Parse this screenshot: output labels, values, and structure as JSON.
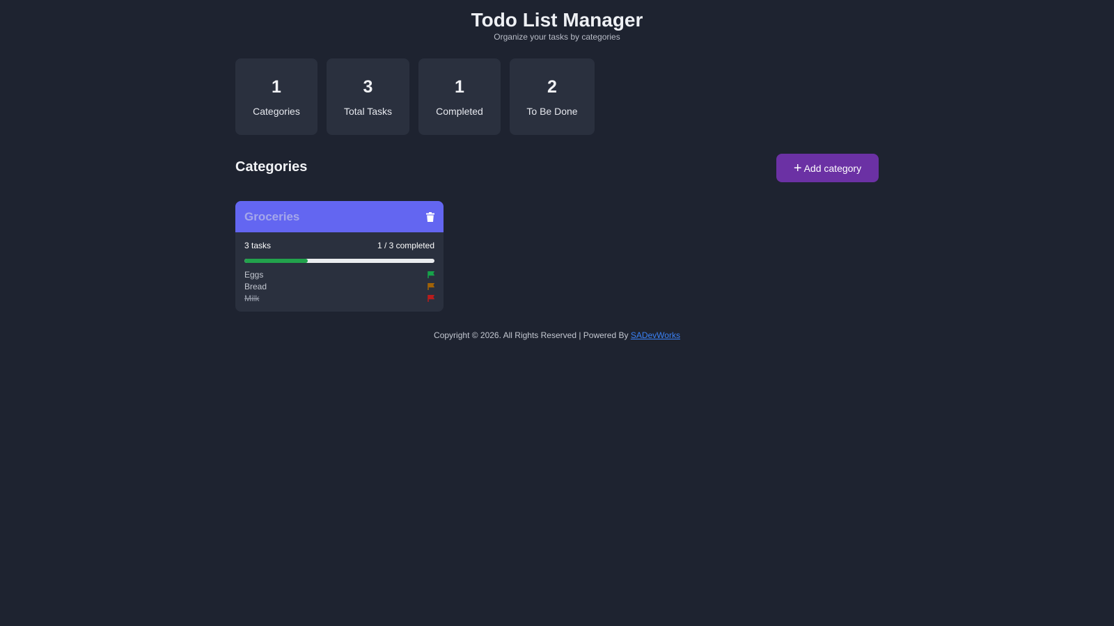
{
  "header": {
    "title": "Todo List Manager",
    "subtitle": "Organize your tasks by categories"
  },
  "stats": [
    {
      "value": "1",
      "label": "Categories"
    },
    {
      "value": "3",
      "label": "Total Tasks"
    },
    {
      "value": "1",
      "label": "Completed"
    },
    {
      "value": "2",
      "label": "To Be Done"
    }
  ],
  "categories_section": {
    "title": "Categories",
    "add_button": {
      "icon": "plus-icon",
      "label": "Add category"
    }
  },
  "categories": [
    {
      "name": "Groceries",
      "tasks_count_label": "3 tasks",
      "completed_label": "1 / 3 completed",
      "progress_fraction": 0.333,
      "delete_icon": "trash-icon",
      "tasks": [
        {
          "name": "Eggs",
          "done": false,
          "flag_color": "#16a34a"
        },
        {
          "name": "Bread",
          "done": false,
          "flag_color": "#a16207"
        },
        {
          "name": "Milk",
          "done": true,
          "flag_color": "#b91c1c"
        }
      ]
    }
  ],
  "footer": {
    "text": "Copyright © 2026. All Rights Reserved | Powered By ",
    "link_text": "SADevWorks"
  },
  "colors": {
    "background": "#1e2330",
    "card": "#2a303e",
    "accent_purple": "#6b31a4",
    "category_header": "#6366f1",
    "progress_green": "#22a24c",
    "link": "#3b82f6"
  }
}
